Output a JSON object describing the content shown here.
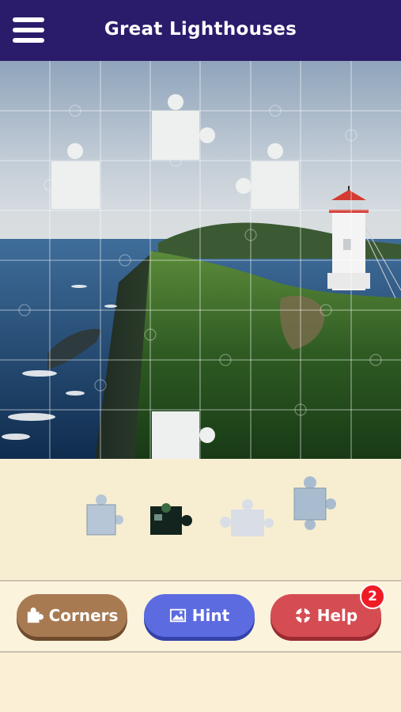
{
  "header": {
    "title": "Great Lighthouses",
    "menu_icon": "hamburger-menu-icon"
  },
  "puzzle": {
    "grid_columns": 8,
    "grid_rows": 8,
    "image_subject": "lighthouse",
    "missing_piece_count": 4,
    "tray_piece_count": 4
  },
  "buttons": {
    "corners": {
      "label": "Corners",
      "icon": "corners-piece-icon",
      "color": "#a87a52"
    },
    "hint": {
      "label": "Hint",
      "icon": "picture-icon",
      "color": "#5c6be0"
    },
    "help": {
      "label": "Help",
      "icon": "lifebuoy-icon",
      "color": "#d54d52",
      "badge": "2"
    }
  },
  "colors": {
    "header": "#2b1b6b",
    "background": "#fbf0d6",
    "badge": "#ee1c25"
  }
}
